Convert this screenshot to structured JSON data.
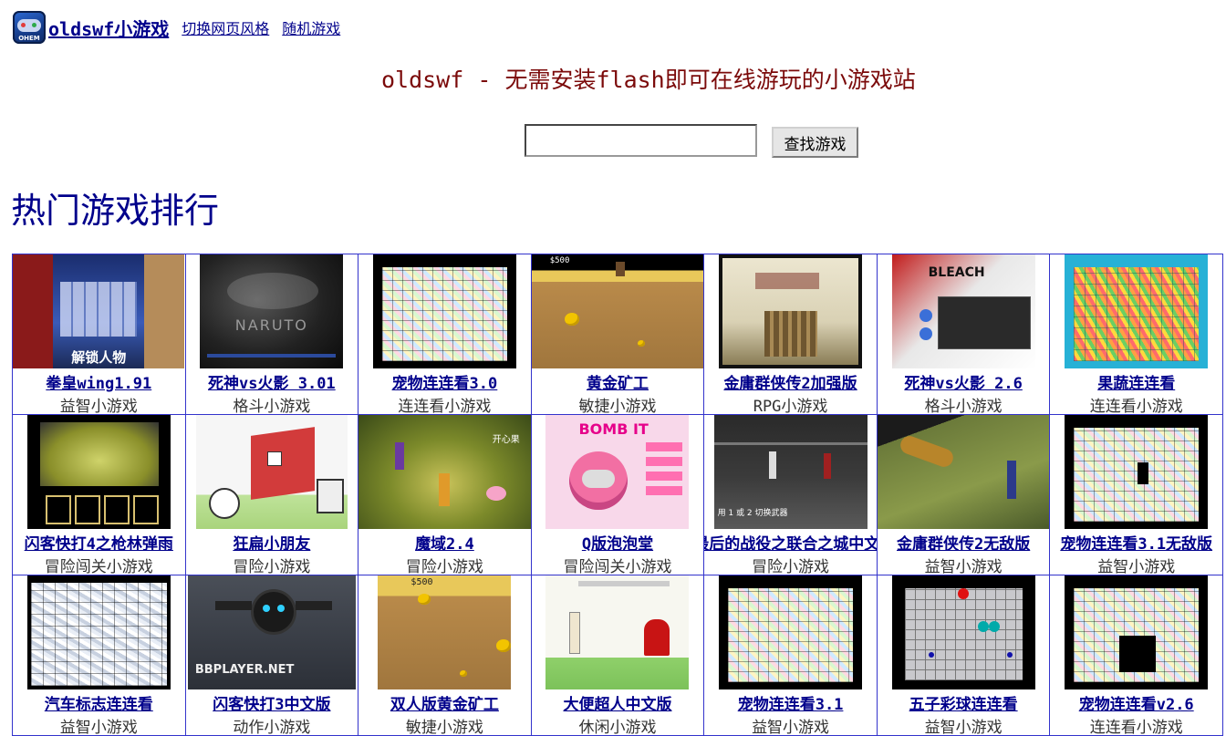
{
  "header": {
    "logo_text": "OHEM",
    "site_name": "oldswf小游戏",
    "nav": [
      "切换网页风格",
      "随机游戏"
    ]
  },
  "tagline": "oldswf - 无需安装flash即可在线游玩的小游戏站",
  "search": {
    "value": "",
    "button_label": "查找游戏"
  },
  "section_title": "热门游戏排行",
  "games": [
    {
      "title": "拳皇wing1.91",
      "category": "益智小游戏",
      "thumb_text": "解锁人物"
    },
    {
      "title": "死神vs火影 3.01",
      "category": "格斗小游戏",
      "thumb_text": "NARUTO"
    },
    {
      "title": "宠物连连看3.0",
      "category": "连连看小游戏",
      "thumb_text": ""
    },
    {
      "title": "黄金矿工",
      "category": "敏捷小游戏",
      "thumb_text": "$500"
    },
    {
      "title": "金庸群侠传2加强版",
      "category": "RPG小游戏",
      "thumb_text": ""
    },
    {
      "title": "死神vs火影 2.6",
      "category": "格斗小游戏",
      "thumb_text": "BLEACH"
    },
    {
      "title": "果蔬连连看",
      "category": "连连看小游戏",
      "thumb_text": ""
    },
    {
      "title": "闪客快打4之枪林弹雨",
      "category": "冒险闯关小游戏",
      "thumb_text": ""
    },
    {
      "title": "狂扁小朋友",
      "category": "冒险小游戏",
      "thumb_text": ""
    },
    {
      "title": "魔域2.4",
      "category": "冒险小游戏",
      "thumb_text": "开心果"
    },
    {
      "title": "Q版泡泡堂",
      "category": "冒险闯关小游戏",
      "thumb_text": "BOMB IT"
    },
    {
      "title": "最后的战役之联合之城中文版",
      "category": "冒险小游戏",
      "thumb_text": "用 1 或 2 切换武器"
    },
    {
      "title": "金庸群侠传2无敌版",
      "category": "益智小游戏",
      "thumb_text": ""
    },
    {
      "title": "宠物连连看3.1无敌版",
      "category": "益智小游戏",
      "thumb_text": ""
    },
    {
      "title": "汽车标志连连看",
      "category": "益智小游戏",
      "thumb_text": ""
    },
    {
      "title": "闪客快打3中文版",
      "category": "动作小游戏",
      "thumb_text": "BBPLAYER.NET"
    },
    {
      "title": "双人版黄金矿工",
      "category": "敏捷小游戏",
      "thumb_text": "$500"
    },
    {
      "title": "大便超人中文版",
      "category": "休闲小游戏",
      "thumb_text": ""
    },
    {
      "title": "宠物连连看3.1",
      "category": "益智小游戏",
      "thumb_text": ""
    },
    {
      "title": "五子彩球连连看",
      "category": "益智小游戏",
      "thumb_text": ""
    },
    {
      "title": "宠物连连看v2.6",
      "category": "连连看小游戏",
      "thumb_text": ""
    }
  ]
}
